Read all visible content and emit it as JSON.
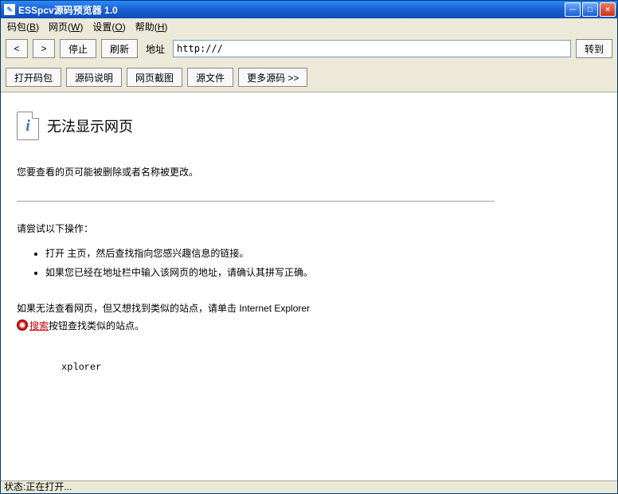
{
  "titlebar": {
    "title": "ESSpcv源码预览器 1.0"
  },
  "menubar": {
    "items": [
      {
        "label": "码包",
        "key": "B"
      },
      {
        "label": "网页",
        "key": "W"
      },
      {
        "label": "设置",
        "key": "O"
      },
      {
        "label": "帮助",
        "key": "H"
      }
    ]
  },
  "toolbar": {
    "back": "<",
    "forward": ">",
    "stop": "停止",
    "refresh": "刷新",
    "addr_label": "地址",
    "addr_value": "http:///",
    "go": "转到"
  },
  "toolbar2": {
    "open_pkg": "打开码包",
    "src_desc": "源码说明",
    "screenshot": "网页截图",
    "src_file": "源文件",
    "more_src": "更多源码 >>"
  },
  "error": {
    "title": "无法显示网页",
    "line1": "您要查看的页可能被删除或者名称被更改。",
    "try_header": "请尝试以下操作：",
    "bullets": [
      "打开  主页，然后查找指向您感兴趣信息的链接。",
      "如果您已经在地址栏中输入该网页的地址，请确认其拼写正确。"
    ],
    "search_prefix": "如果无法查看网页，但又想找到类似的站点，请单击 Internet Explorer",
    "search_link": "搜索",
    "search_suffix": "按钮查找类似的站点。",
    "fragment": "xplorer"
  },
  "statusbar": {
    "text": "状态:正在打开..."
  }
}
